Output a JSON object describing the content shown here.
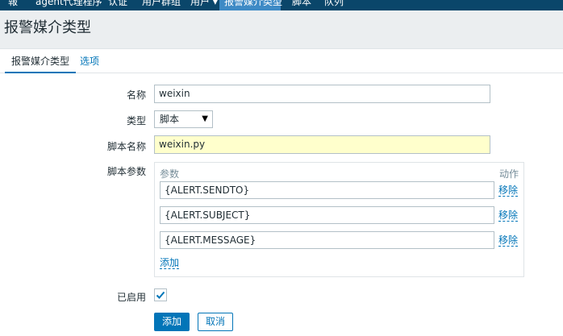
{
  "top_nav": {
    "items": [
      {
        "label": "報"
      },
      {
        "label": "agent代理程序"
      },
      {
        "label": "认证"
      },
      {
        "label": "用户群组"
      },
      {
        "label": "用户 ▾"
      },
      {
        "label": "报警媒介类型"
      },
      {
        "label": "脚本"
      },
      {
        "label": "队列"
      }
    ]
  },
  "page": {
    "title": "报警媒介类型"
  },
  "tabs": [
    {
      "label": "报警媒介类型"
    },
    {
      "label": "选项"
    }
  ],
  "form": {
    "name": {
      "label": "名称",
      "value": "weixin"
    },
    "type": {
      "label": "类型",
      "value": "脚本"
    },
    "script_name": {
      "label": "脚本名称",
      "value": "weixin.py"
    },
    "script_params": {
      "label": "脚本参数",
      "header_param": "参数",
      "header_action": "动作",
      "rows": [
        {
          "value": "{ALERT.SENDTO}",
          "remove": "移除"
        },
        {
          "value": "{ALERT.SUBJECT}",
          "remove": "移除"
        },
        {
          "value": "{ALERT.MESSAGE}",
          "remove": "移除"
        }
      ],
      "add_link": "添加"
    },
    "enabled": {
      "label": "已启用",
      "checked": true
    }
  },
  "buttons": {
    "add": "添加",
    "cancel": "取消"
  },
  "colors": {
    "nav_bg": "#0a466a",
    "nav_active": "#3e8ac5",
    "accent": "#0275b8",
    "highlight_input": "#ffffcc"
  }
}
